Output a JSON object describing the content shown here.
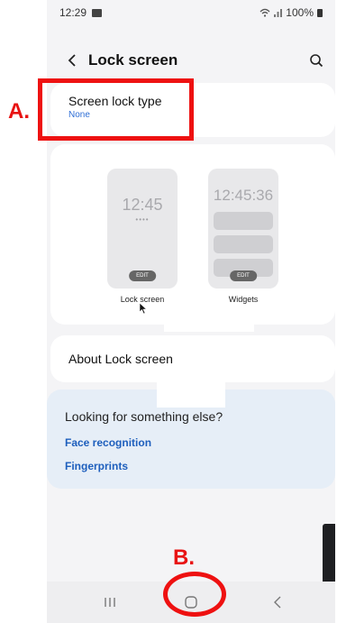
{
  "status_bar": {
    "time": "12:29",
    "battery": "100%"
  },
  "header": {
    "title": "Lock screen"
  },
  "screen_lock_type": {
    "label": "Screen lock type",
    "value": "None"
  },
  "preview": {
    "lock": {
      "time": "12:45",
      "edit": "EDIT",
      "label": "Lock screen"
    },
    "widgets": {
      "time": "12:45:36",
      "edit": "EDIT",
      "label": "Widgets"
    }
  },
  "about": {
    "label": "About Lock screen"
  },
  "looking": {
    "title": "Looking for something else?",
    "links": [
      "Face recognition",
      "Fingerprints"
    ]
  },
  "annotations": {
    "a": "A.",
    "b": "B."
  },
  "colors": {
    "annotation": "#ee1111",
    "link": "#1e5fbd",
    "value": "#2f6fd6"
  }
}
